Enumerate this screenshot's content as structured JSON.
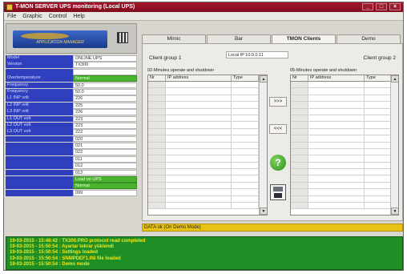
{
  "window": {
    "title": "T-MON SERVER UPS monitoring (Local UPS)"
  },
  "window_controls": {
    "minimize": "_",
    "maximize": "□",
    "close": "×"
  },
  "menu": [
    "File",
    "Graphic",
    "Control",
    "Help"
  ],
  "logo": {
    "text": "APPLICATION MANAGER"
  },
  "info_rows": [
    {
      "label": "Model",
      "value": "ONLINE UPS",
      "green": false
    },
    {
      "label": "Version",
      "value": "TX300",
      "green": false
    },
    {
      "label": "",
      "value": "",
      "green": false
    },
    {
      "label": "Overtemperature",
      "value": "Normal",
      "green": true
    },
    {
      "label": "Frequency",
      "value": "50.0",
      "green": false
    },
    {
      "label": "Frequency",
      "value": "50.0",
      "green": false
    },
    {
      "label": "L1 INP volt",
      "value": "226",
      "green": false
    },
    {
      "label": "L2 INP volt",
      "value": "225",
      "green": false
    },
    {
      "label": "L3 INP volt",
      "value": "226",
      "green": false
    },
    {
      "label": "L1 OUT volt",
      "value": "223",
      "green": false
    },
    {
      "label": "L2 OUT volt",
      "value": "223",
      "green": false
    },
    {
      "label": "L3 OUT volt",
      "value": "222",
      "green": false
    },
    {
      "label": "",
      "value": "020",
      "green": false
    },
    {
      "label": "",
      "value": "021",
      "green": false
    },
    {
      "label": "",
      "value": "022",
      "green": false
    },
    {
      "label": "",
      "value": "011",
      "green": false
    },
    {
      "label": "",
      "value": "012",
      "green": false
    },
    {
      "label": "",
      "value": "013",
      "green": false
    },
    {
      "label": "",
      "value": "Load on UPS",
      "green": true
    },
    {
      "label": "",
      "value": "Normal",
      "green": true
    },
    {
      "label": "",
      "value": "099",
      "green": false
    }
  ],
  "tabs": [
    {
      "label": "Mimic",
      "active": false
    },
    {
      "label": "Bar",
      "active": false
    },
    {
      "label": "TMON Clients",
      "active": true
    },
    {
      "label": "Demo",
      "active": false
    }
  ],
  "clients": {
    "group1_label": "Client group 1",
    "local_ip": "Local IP 10.0.0.11",
    "group2_label": "Client group 2",
    "group1_caption": "02-Minutes operate and shutdown",
    "group2_caption": "05-Minutes operate and shutdown",
    "columns": {
      "nr": "Nr",
      "ip": "IP address",
      "type": "Type"
    },
    "move_right": ">>>",
    "move_left": "<<<",
    "help": "?"
  },
  "status_text": "DATA ok (On Demo Mode)",
  "log_lines": [
    "19-03-2015 - 15:48:42 : TX300.PRO protocol read completed",
    "19-03-2015 - 15:50:54 : Ayarlar tekrar yüklendi",
    "19-03-2015 - 15:50:54 : Settings loaded",
    "19-03-2015 - 15:50:54 : SNMPDEF1.INI file loaded",
    "19-03-2015 - 15:50:54 : Demo mode"
  ],
  "colors": {
    "label_bg": "#2f3fbd",
    "green": "#49b22e",
    "status": "#e9c215",
    "log_bg": "#1e8f25",
    "log_text": "#f1e61a"
  }
}
